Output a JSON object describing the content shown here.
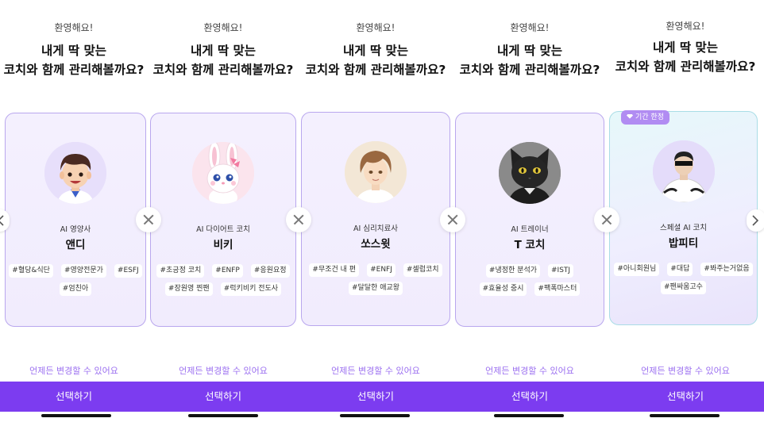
{
  "panels": [
    {
      "welcome": "환영해요!",
      "headline_line1": "내게 딱 맞는",
      "headline_line2": "코치와 함께 관리해볼까요?",
      "coach": {
        "role": "AI 영양사",
        "name": "앤디",
        "tags": [
          "#혈당&식단",
          "#영양전문가",
          "#ESFJ",
          "#엄친아"
        ]
      },
      "note": "언제든 변경할 수 있어요",
      "button": "선택하기"
    },
    {
      "welcome": "환영해요!",
      "headline_line1": "내게 딱 맞는",
      "headline_line2": "코치와 함께 관리해볼까요?",
      "coach": {
        "role": "AI 다이어트 코치",
        "name": "비키",
        "tags": [
          "#초긍정 코치",
          "#ENFP",
          "#응원요정",
          "#장원영 찐팬",
          "#럭키비키 전도사"
        ]
      },
      "note": "언제든 변경할 수 있어요",
      "button": "선택하기"
    },
    {
      "welcome": "환영해요!",
      "headline_line1": "내게 딱 맞는",
      "headline_line2": "코치와 함께 관리해볼까요?",
      "coach": {
        "role": "AI 심리치료사",
        "name": "쏘스윗",
        "tags": [
          "#무조건 내 편",
          "#ENFJ",
          "#셀럽코치",
          "#달달한 애교왕"
        ]
      },
      "note": "언제든 변경할 수 있어요",
      "button": "선택하기"
    },
    {
      "welcome": "환영해요!",
      "headline_line1": "내게 딱 맞는",
      "headline_line2": "코치와 함께 관리해볼까요?",
      "coach": {
        "role": "AI 트레이너",
        "name": "T 코치",
        "tags": [
          "#냉정한 분석가",
          "#ISTJ",
          "#효율성 중시",
          "#팩폭마스터"
        ]
      },
      "note": "언제든 변경할 수 있어요",
      "button": "선택하기"
    },
    {
      "welcome": "환영해요!",
      "headline_line1": "내게 딱 맞는",
      "headline_line2": "코치와 함께 관리해볼까요?",
      "coach": {
        "badge": "기간 한정",
        "role": "스페셜 AI 코치",
        "name": "밥피티",
        "tags": [
          "#아니회원님",
          "#대답",
          "#봐주는거없음",
          "#팬싸움고수"
        ]
      },
      "note": "언제든 변경할 수 있어요",
      "button": "선택하기"
    }
  ],
  "icons": {
    "close": "close-icon",
    "prev": "chevron-left-icon",
    "next": "chevron-right-icon",
    "badge": "diamond-icon"
  },
  "colors": {
    "accent": "#7c3cf0",
    "card_border": "#b9a7ee",
    "card_bg": "#f2edfd",
    "note": "#9b6ff0",
    "badge": "#b18cf2"
  }
}
